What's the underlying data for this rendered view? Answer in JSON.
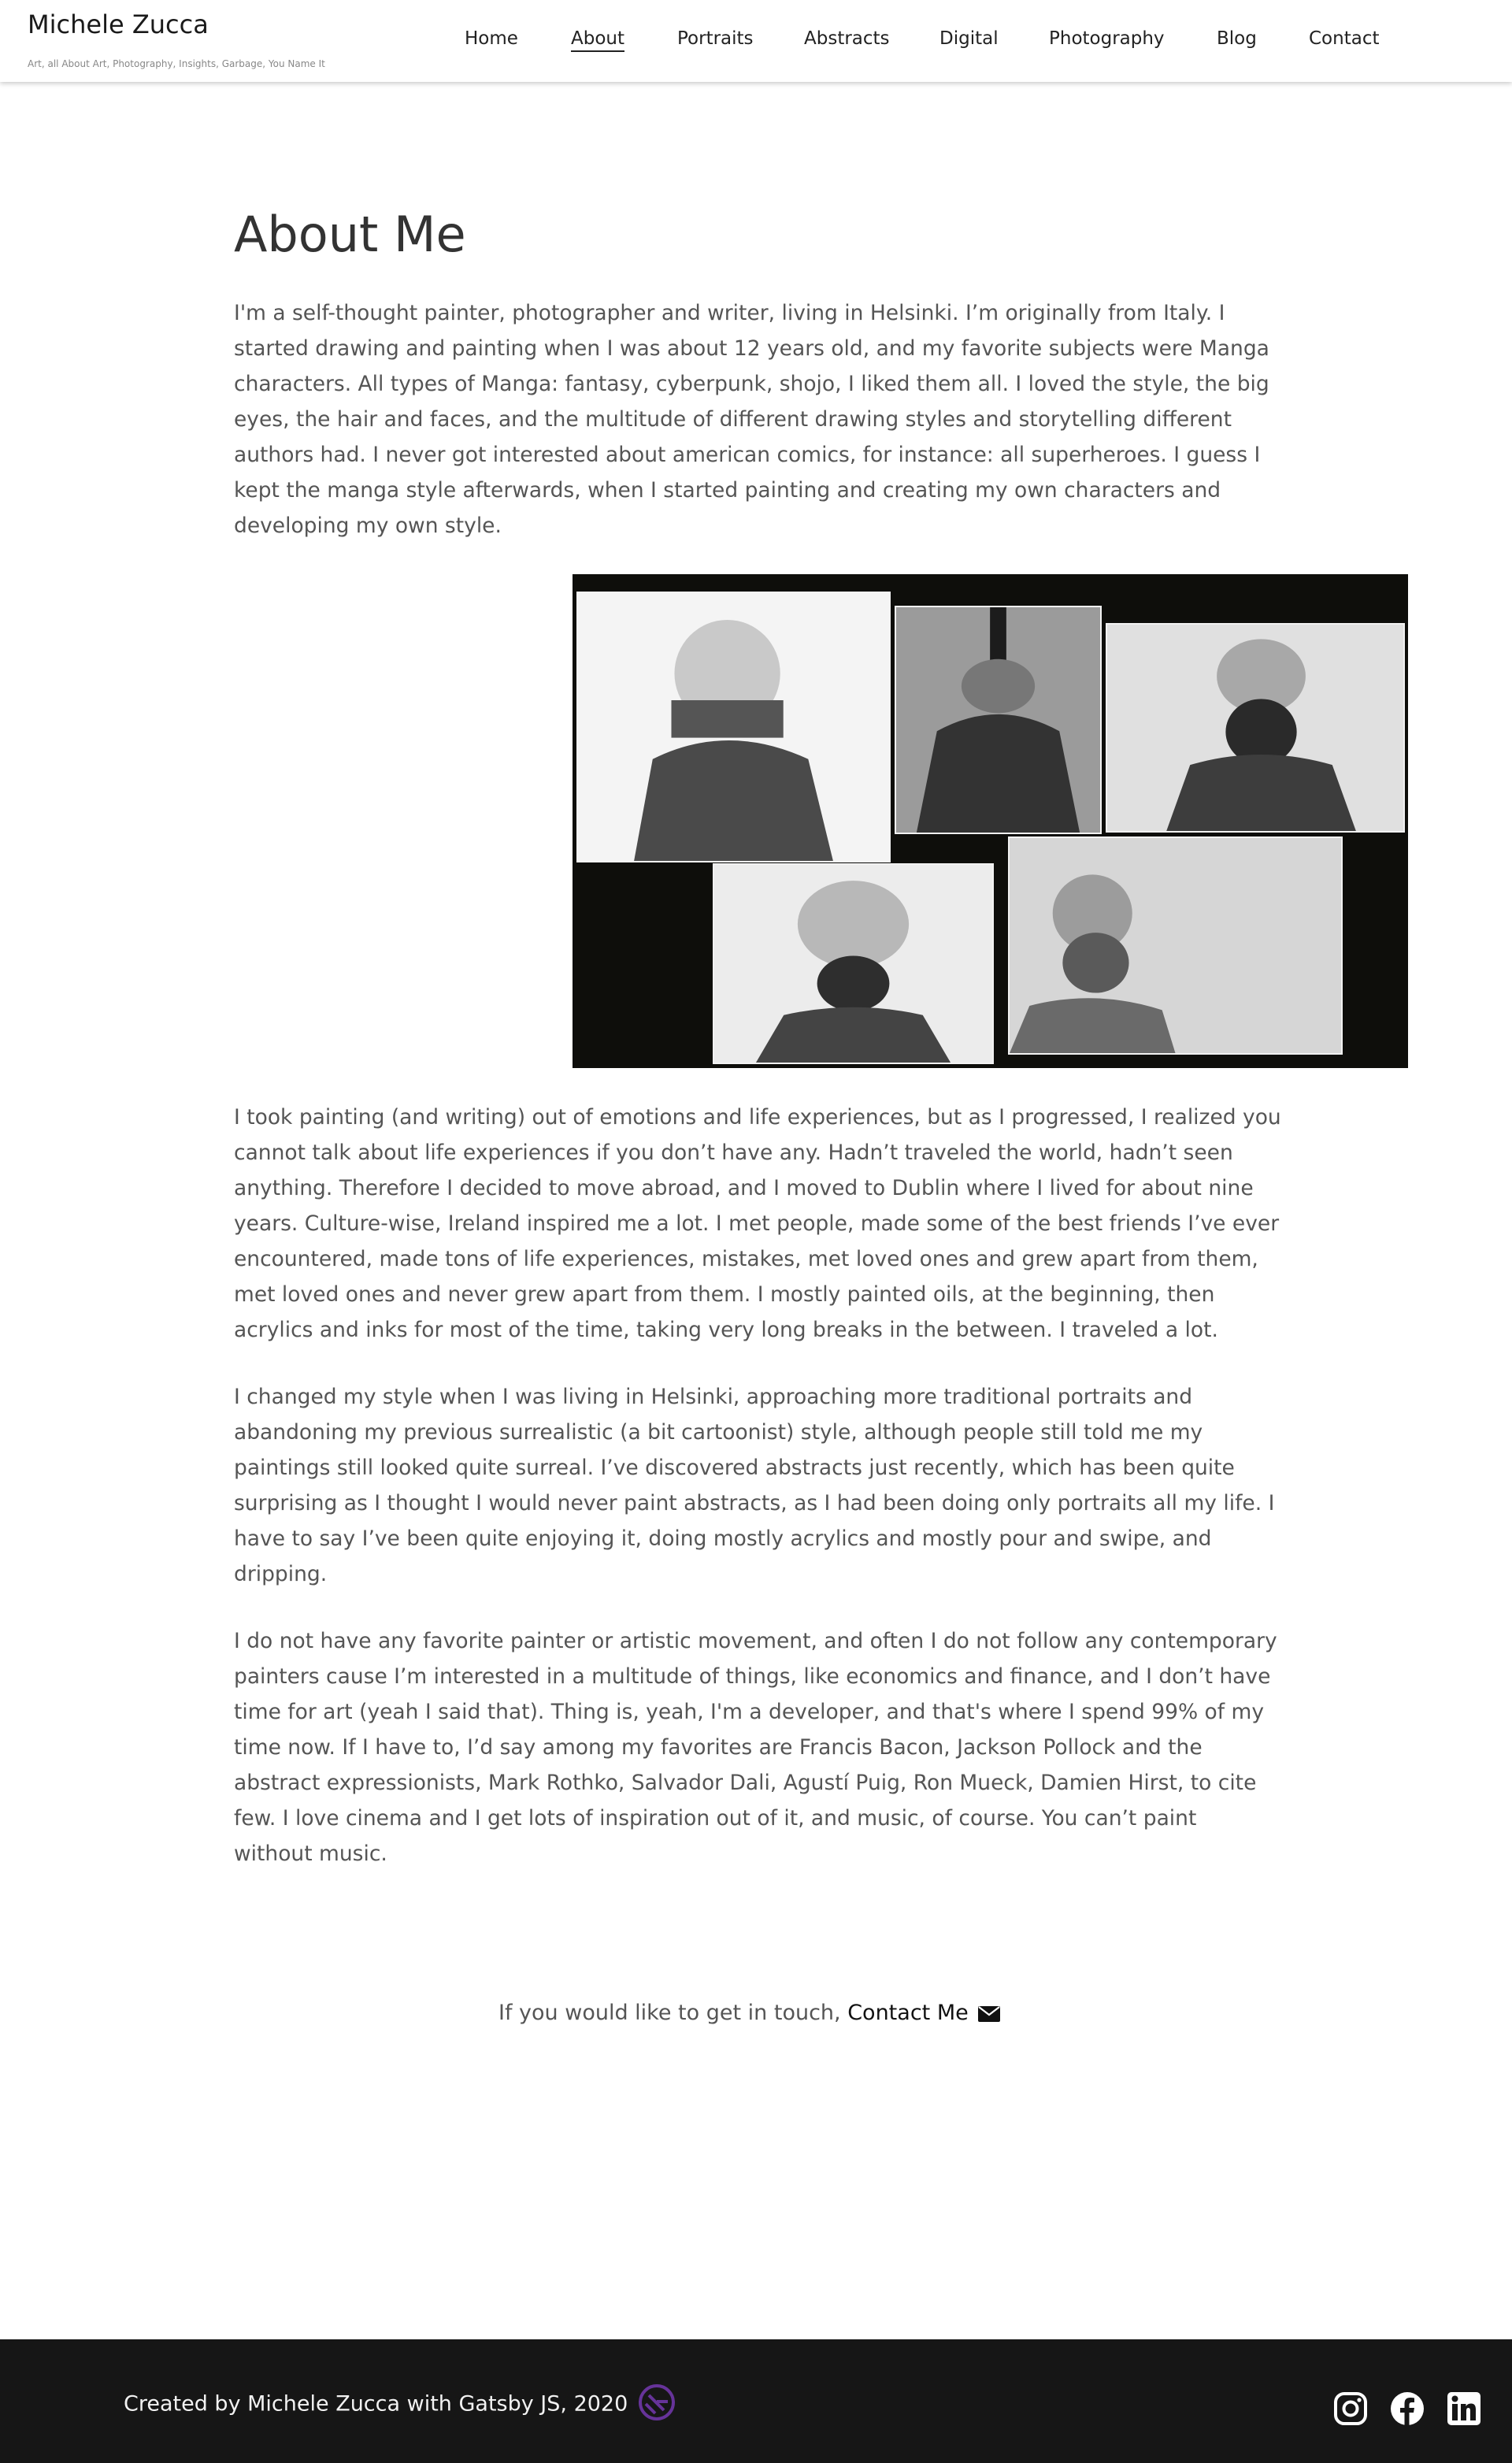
{
  "site": {
    "title": "Michele Zucca",
    "tagline": "Art, all About Art, Photography, Insights, Garbage, You Name It"
  },
  "nav": {
    "items": [
      {
        "label": "Home"
      },
      {
        "label": "About",
        "active": true
      },
      {
        "label": "Portraits"
      },
      {
        "label": "Abstracts"
      },
      {
        "label": "Digital"
      },
      {
        "label": "Photography"
      },
      {
        "label": "Blog"
      },
      {
        "label": "Contact"
      }
    ]
  },
  "main": {
    "title": "About Me",
    "paragraphs": [
      "I'm a self-thought painter, photographer and writer, living in Helsinki. I’m originally from Italy. I started drawing and painting when I was about 12 years old, and my favorite subjects were Manga characters. All types of Manga: fantasy, cyberpunk, shojo, I liked them all. I loved the style, the big eyes, the hair and faces, and the multitude of  different drawing styles and storytelling different authors had. I never got interested about american comics, for instance: all superheroes. I guess I kept the manga style afterwards, when I started painting and creating my own characters and developing my own style.",
      "I took painting (and writing) out of emotions and life experiences, but as I progressed, I realized you cannot talk about life experiences if you don’t have any. Hadn’t traveled the world, hadn’t seen anything. Therefore I decided to move abroad, and I moved to Dublin where I lived for about nine years. Culture-wise, Ireland inspired me a lot. I met people, made some of the best friends I’ve ever encountered, made tons of life experiences, mistakes, met loved ones and grew apart from them, met loved ones and never grew apart from them. I mostly painted oils, at the beginning, then acrylics and inks for most of the time, taking very long breaks in the between. I traveled a lot.",
      "I changed my style when I was living in Helsinki, approaching more traditional portraits and abandoning my previous surrealistic (a bit cartoonist) style, although people still told me my paintings still looked quite surreal. I’ve discovered abstracts just recently, which has been quite surprising as I thought I would never paint abstracts, as I had been doing only portraits all my life. I have to say I’ve been quite enjoying it, doing mostly acrylics and mostly pour and swipe, and dripping.",
      "I do not have any favorite painter or artistic movement, and often I do not follow any contemporary painters cause I’m interested in a multitude of things, like economics and finance, and I don’t have time for art (yeah I said that). Thing is, yeah, I'm a developer, and that's where I spend 99% of my time now. If I have to, I’d say among my favorites are Francis Bacon, Jackson Pollock and the abstract expressionists, Mark Rothko, Salvador Dali, Agustí Puig, Ron Mueck, Damien Hirst, to cite few. I love cinema and I get lots of inspiration out of it, and music, of course. You can’t paint without music."
    ]
  },
  "contact_cta": {
    "text": "If you would like to get in touch, ",
    "link_label": "Contact Me",
    "icon": "envelope-icon"
  },
  "footer": {
    "credit": "Created by Michele Zucca with Gatsby JS, 2020",
    "credit_icon": "gatsby-logo-icon",
    "social": [
      "instagram-icon",
      "facebook-icon",
      "linkedin-icon"
    ]
  },
  "colors": {
    "footer_bg": "#161616",
    "gatsby_purple": "#663399",
    "collage_bg": "#0e0e0b"
  }
}
